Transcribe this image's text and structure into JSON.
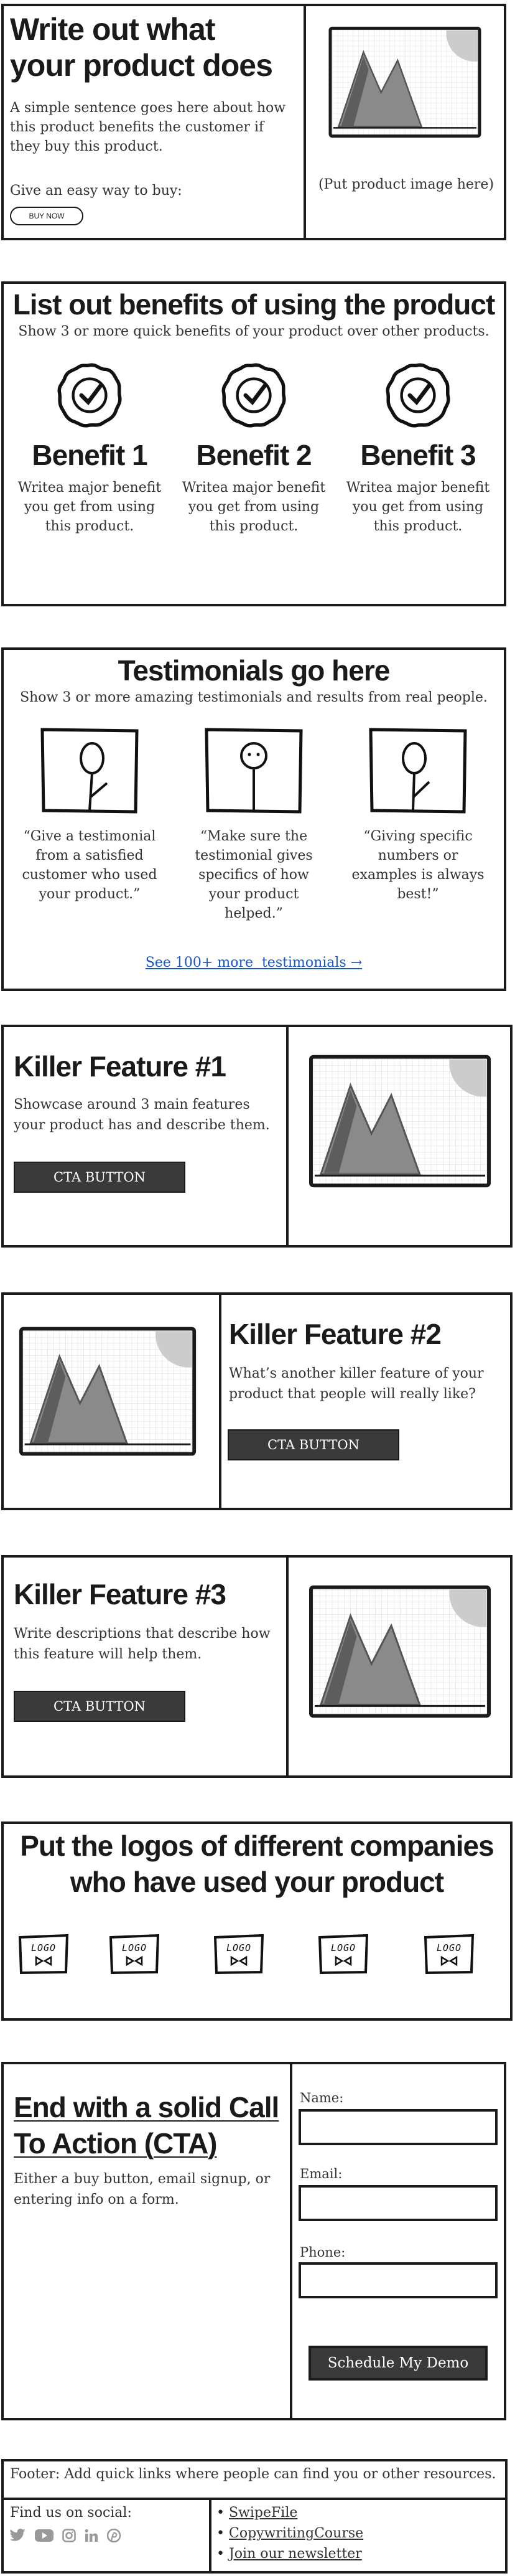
{
  "hero": {
    "title": "Write out what your product does",
    "desc": "A simple sentence goes here about how this product benefits the customer if they buy this product.",
    "buy_text": "Give an easy way to buy:",
    "buy_btn": "BUY NOW",
    "image_caption": "(Put product image here)"
  },
  "benefits": {
    "title": "List out benefits of using the product",
    "subtitle": "Show 3 or more quick benefits of your product over other products.",
    "items": [
      {
        "title": "Benefit 1",
        "text": "Writea major benefit you get from using this product."
      },
      {
        "title": "Benefit 2",
        "text": "Writea major benefit you get from using this product."
      },
      {
        "title": "Benefit 3",
        "text": "Writea major benefit you get from using this product."
      }
    ]
  },
  "testimonials": {
    "title": "Testimonials go here",
    "subtitle": "Show 3 or more amazing testimonials and results from real people.",
    "items": [
      {
        "quote": "“Give a testimonial from a satisfied customer who used your product.”"
      },
      {
        "quote": "“Make sure the testimonial gives specifics of how your product helped.”"
      },
      {
        "quote": "“Giving specific numbers or examples is always best!”"
      }
    ],
    "link": "See 100+ more  testimonials →"
  },
  "features": [
    {
      "title": "Killer Feature #1",
      "text": "Showcase around 3 main features your product has and describe them.",
      "cta": "CTA BUTTON"
    },
    {
      "title": "Killer Feature #2",
      "text": "What’s another killer feature of your product that people will really like?",
      "cta": "CTA BUTTON"
    },
    {
      "title": "Killer Feature #3",
      "text": "Write descriptions that describe how this feature will help them.",
      "cta": "CTA BUTTON"
    }
  ],
  "logos": {
    "title": "Put the logos of different companies who have used your product",
    "items": [
      "LOGO",
      "LOGO",
      "LOGO",
      "LOGO",
      "LOGO"
    ]
  },
  "cta_section": {
    "title": "End with a solid Call To Action (CTA)",
    "desc": "Either a buy button, email signup, or entering info on a form.",
    "fields": [
      {
        "label": "Name:",
        "value": ""
      },
      {
        "label": "Email:",
        "value": ""
      },
      {
        "label": "Phone:",
        "value": ""
      }
    ],
    "submit": "Schedule My Demo"
  },
  "footer": {
    "note": "Footer: Add quick links where people can find you or other resources.",
    "social_label": "Find us on social:",
    "social_icons": [
      "twitter-icon",
      "youtube-icon",
      "instagram-icon",
      "linkedin-icon",
      "pinterest-icon"
    ],
    "links": [
      "SwipeFile",
      "CopywritingCourse",
      "Join our newsletter"
    ]
  },
  "colors": {
    "border": "#1a1a1a",
    "button": "#3a3a3a",
    "link": "#1a56c4"
  }
}
